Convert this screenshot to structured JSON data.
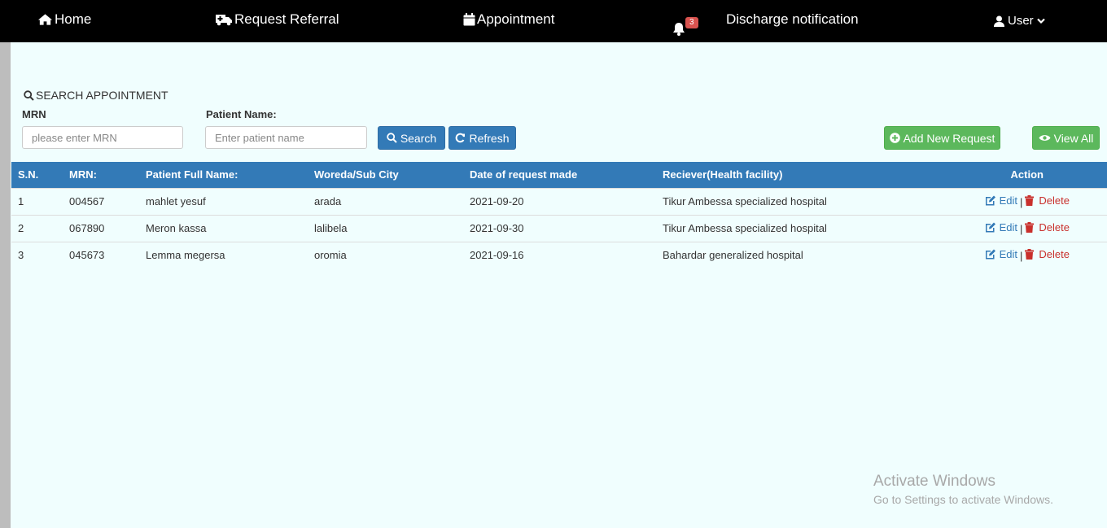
{
  "nav": {
    "home": "Home",
    "request_referral": "Request Referral",
    "appointment": "Appointment",
    "notification_count": "3",
    "discharge": "Discharge notification",
    "user": "User"
  },
  "search": {
    "title": "SEARCH APPOINTMENT",
    "mrn_label": "MRN",
    "mrn_placeholder": "please enter MRN",
    "name_label": "Patient Name:",
    "name_placeholder": "Enter patient name",
    "search_button": "Search",
    "refresh_button": "Refresh",
    "add_button": "Add New Request",
    "view_all_button": "View All"
  },
  "table": {
    "headers": [
      "S.N.",
      "MRN:",
      "Patient Full Name:",
      "Woreda/Sub City",
      "Date of request made",
      "Reciever(Health facility)",
      "Action"
    ],
    "rows": [
      {
        "sn": "1",
        "mrn": "004567",
        "name": "mahlet yesuf",
        "woreda": "arada",
        "date": "2021-09-20",
        "receiver": "Tikur Ambessa specialized hospital"
      },
      {
        "sn": "2",
        "mrn": "067890",
        "name": "Meron kassa",
        "woreda": "lalibela",
        "date": "2021-09-30",
        "receiver": "Tikur Ambessa specialized hospital"
      },
      {
        "sn": "3",
        "mrn": "045673",
        "name": "Lemma megersa",
        "woreda": "oromia",
        "date": "2021-09-16",
        "receiver": "Bahardar generalized hospital"
      }
    ],
    "edit_label": "Edit",
    "separator": "|",
    "delete_label": "Delete"
  },
  "watermark": {
    "title": "Activate Windows",
    "subtitle": "Go to Settings to activate Windows."
  },
  "colors": {
    "topbar": "#000000",
    "content_bg": "#f0fefe",
    "primary": "#337ab7",
    "success": "#5cb85c",
    "danger": "#c9302c",
    "badge": "#d9534f"
  },
  "icons": {
    "home": "home-icon",
    "referral": "ambulance-icon",
    "appointment": "calendar-icon",
    "notification": "bell-icon",
    "user": "user-icon",
    "search": "search-icon",
    "refresh": "refresh-icon",
    "add": "plus-circle-icon",
    "view": "eye-icon",
    "edit": "edit-icon",
    "delete": "trash-icon"
  }
}
